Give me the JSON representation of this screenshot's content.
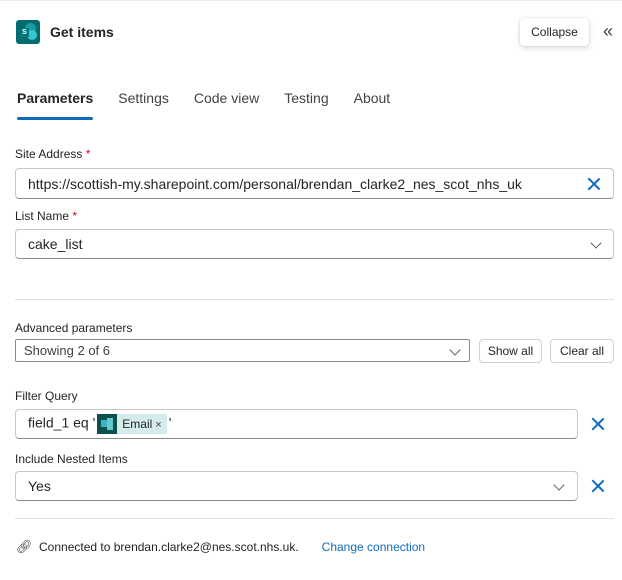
{
  "header": {
    "title": "Get items",
    "app_icon": "sharepoint-icon",
    "tooltip": "Collapse",
    "collapse_icon": "double-chevron-left-icon"
  },
  "tabs": [
    {
      "label": "Parameters",
      "active": true
    },
    {
      "label": "Settings",
      "active": false
    },
    {
      "label": "Code view",
      "active": false
    },
    {
      "label": "Testing",
      "active": false
    },
    {
      "label": "About",
      "active": false
    }
  ],
  "fields": {
    "site_address": {
      "label": "Site Address",
      "required_mark": "*",
      "value": "https://scottish-my.sharepoint.com/personal/brendan_clarke2_nes_scot_nhs_uk",
      "clear_icon": "close-icon"
    },
    "list_name": {
      "label": "List Name",
      "required_mark": "*",
      "value": "cake_list",
      "dropdown_icon": "chevron-down-icon"
    }
  },
  "advanced": {
    "label": "Advanced parameters",
    "value": "Showing 2 of 6",
    "show_all": "Show all",
    "clear_all": "Clear all"
  },
  "filter_query": {
    "label": "Filter Query",
    "prefix": "field_1 eq '",
    "token": {
      "label": "Email",
      "remove": "×",
      "icon": "forms-icon"
    },
    "suffix": "'"
  },
  "nested_items": {
    "label": "Include Nested Items",
    "value": "Yes"
  },
  "footer": {
    "connection_text": "Connected to brendan.clarke2@nes.scot.nhs.uk.",
    "change_connection": "Change connection",
    "icon": "link-icon"
  },
  "colors": {
    "accent": "#0f6cbd",
    "sharepoint": "#036c70",
    "required": "#c50f1f"
  }
}
